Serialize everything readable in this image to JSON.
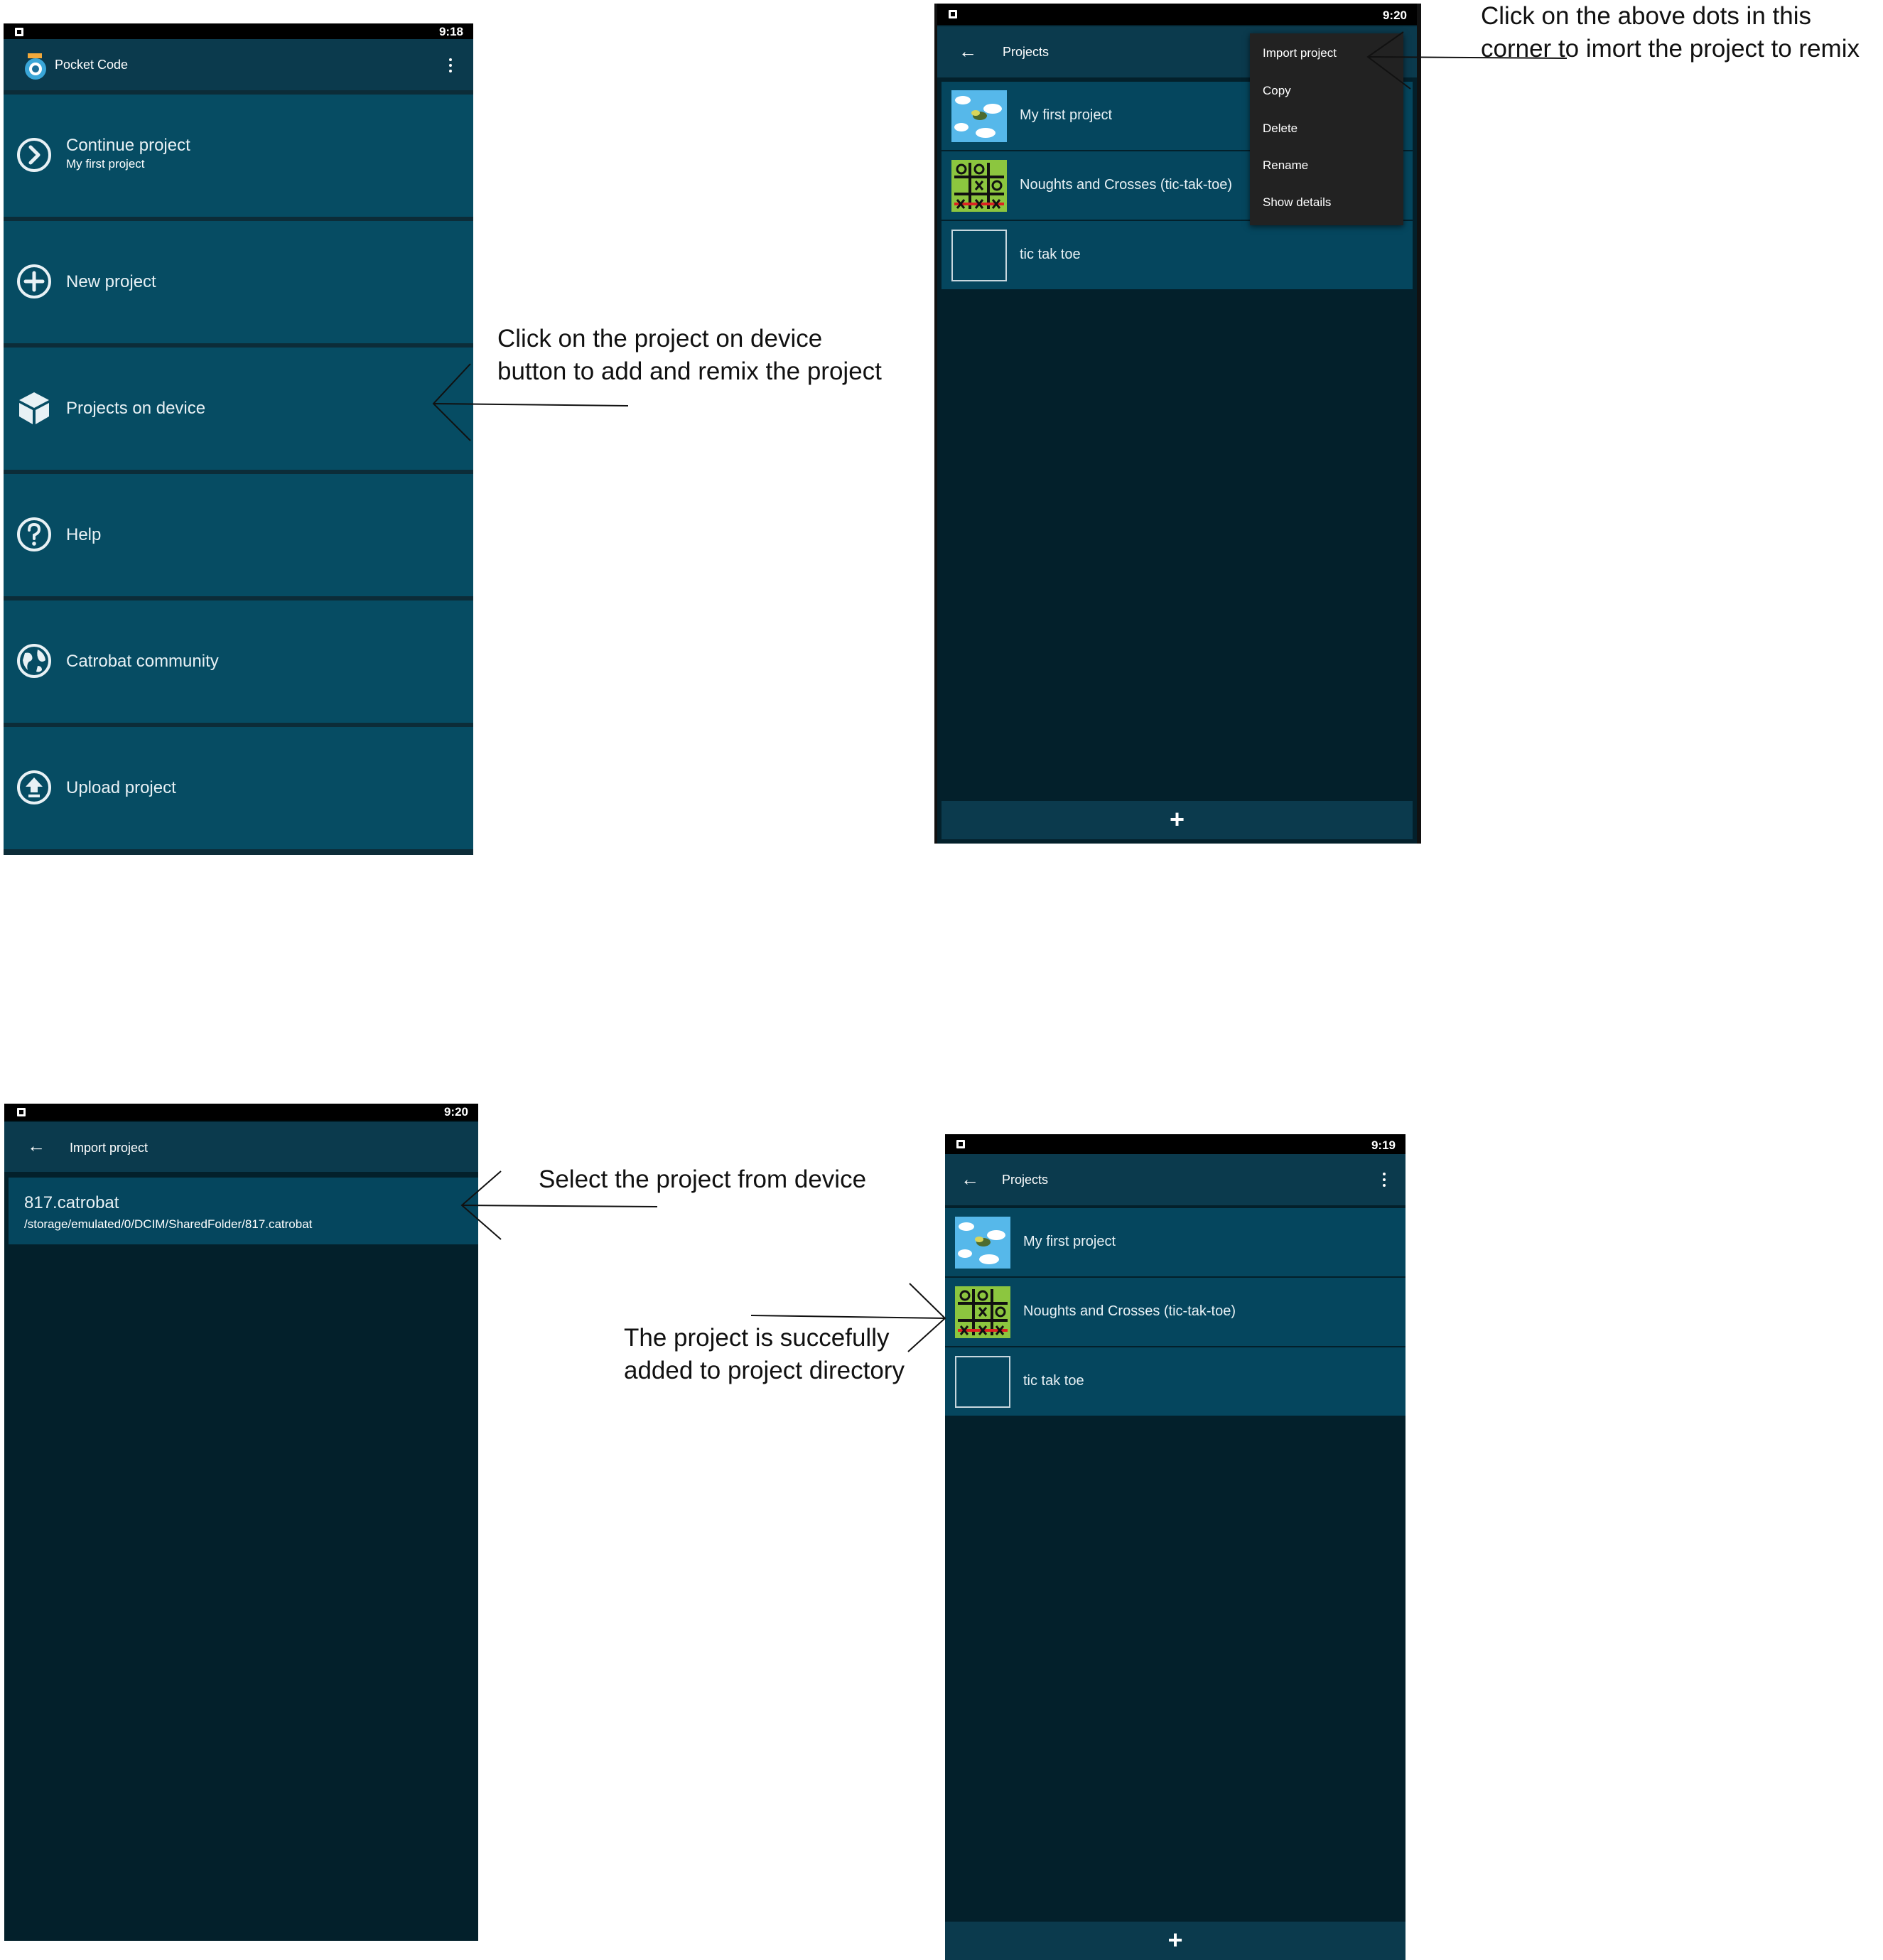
{
  "screen1": {
    "status_time": "9:18",
    "app_title": "Pocket Code",
    "menu": [
      {
        "label": "Continue project",
        "sub": "My first project",
        "icon": "chevron-circle-icon"
      },
      {
        "label": "New project",
        "sub": "",
        "icon": "plus-circle-icon"
      },
      {
        "label": "Projects on device",
        "sub": "",
        "icon": "cube-icon"
      },
      {
        "label": "Help",
        "sub": "",
        "icon": "question-circle-icon"
      },
      {
        "label": "Catrobat community",
        "sub": "",
        "icon": "globe-icon"
      },
      {
        "label": "Upload project",
        "sub": "",
        "icon": "upload-circle-icon"
      }
    ]
  },
  "screen2": {
    "status_time": "9:20",
    "title": "Projects",
    "projects": [
      {
        "name": "My first project",
        "thumb": "sky-thumbnail"
      },
      {
        "name": "Noughts and Crosses (tic-tak-toe)",
        "thumb": "tictactoe-thumbnail"
      },
      {
        "name": "tic tak toe",
        "thumb": "empty-thumbnail"
      }
    ],
    "popup_menu": [
      "Import project",
      "Copy",
      "Delete",
      "Rename",
      "Show details"
    ],
    "fab": "+"
  },
  "screen3": {
    "status_time": "9:20",
    "title": "Import project",
    "file_name": "817.catrobat",
    "file_path": "/storage/emulated/0/DCIM/SharedFolder/817.catrobat"
  },
  "screen4": {
    "status_time": "9:19",
    "title": "Projects",
    "projects": [
      {
        "name": "My first project",
        "thumb": "sky-thumbnail"
      },
      {
        "name": "Noughts and Crosses (tic-tak-toe)",
        "thumb": "tictactoe-thumbnail"
      },
      {
        "name": "tic tak toe",
        "thumb": "empty-thumbnail"
      }
    ],
    "fab": "+"
  },
  "annotations": {
    "a1_line1": "Click on the project on device",
    "a1_line2": "button to add and remix the project",
    "a2_line1": "Click on the above dots in this",
    "a2_line2": "corner to imort the project to remix",
    "a3": "Select the project from device",
    "a4_line1": "The project is succefully",
    "a4_line2": "added to project directory"
  },
  "colors": {
    "toolbar": "#0b3a4d",
    "list_item": "#05465e",
    "menu_item": "#064c63",
    "background": "#03202b",
    "popup": "#222222"
  }
}
